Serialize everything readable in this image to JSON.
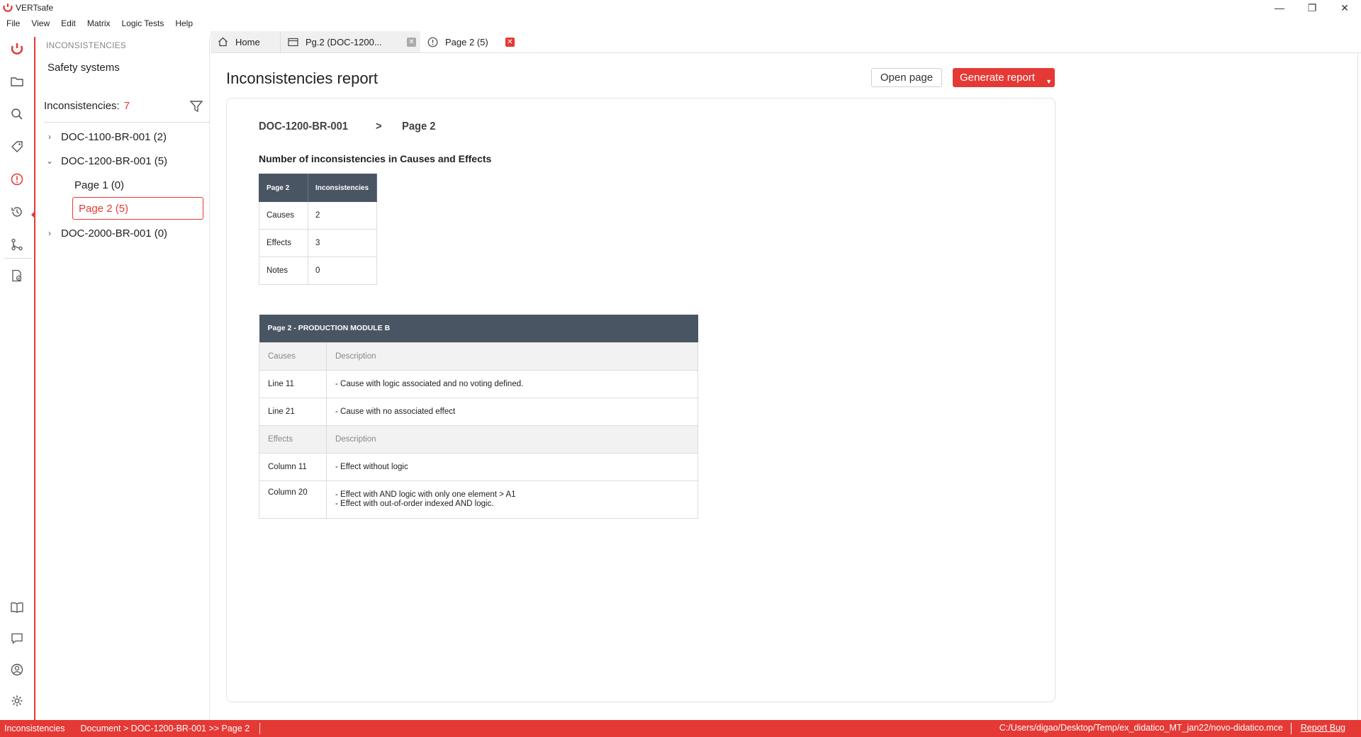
{
  "app": {
    "title": "VERTsafe"
  },
  "window": {
    "minimize": "—",
    "restore": "❐",
    "close": "✕"
  },
  "menu": [
    "File",
    "View",
    "Edit",
    "Matrix",
    "Logic Tests",
    "Help"
  ],
  "sidebar": {
    "section": "INCONSISTENCIES",
    "project": "Safety systems",
    "count_label": "Inconsistencies:",
    "count_value": "7",
    "tree": [
      {
        "label": "DOC-1100-BR-001 (2)",
        "expanded": false
      },
      {
        "label": "DOC-1200-BR-001 (5)",
        "expanded": true
      },
      {
        "label": "Page 1 (0)"
      },
      {
        "label": "Page 2 (5)",
        "selected": true
      },
      {
        "label": "DOC-2000-BR-001 (0)",
        "expanded": false
      }
    ]
  },
  "tabs": [
    {
      "label": "Home"
    },
    {
      "label": "Pg.2 (DOC-1200..."
    },
    {
      "label": "Page 2 (5)",
      "active": true
    }
  ],
  "main": {
    "title": "Inconsistencies report",
    "open_page": "Open page",
    "generate_report": "Generate report",
    "crumb_doc": "DOC-1200-BR-001",
    "crumb_sep": ">",
    "crumb_page": "Page 2",
    "summary_heading": "Number of inconsistencies in Causes and Effects",
    "summary_table": {
      "headers": [
        "Page 2",
        "Inconsistencies"
      ],
      "rows": [
        [
          "Causes",
          "2"
        ],
        [
          "Effects",
          "3"
        ],
        [
          "Notes",
          "0"
        ]
      ]
    },
    "detail_table": {
      "title": "Page 2 - PRODUCTION MODULE B",
      "causes_header": [
        "Causes",
        "Description"
      ],
      "causes": [
        [
          "Line 11",
          "- Cause with logic associated and no voting defined."
        ],
        [
          "Line 21",
          "- Cause with no associated effect"
        ]
      ],
      "effects_header": [
        "Effects",
        "Description"
      ],
      "effects": [
        [
          "Column 11",
          "- Effect without logic"
        ],
        [
          "Column 20",
          "- Effect with AND logic with only one element > A1",
          "- Effect with out-of-order indexed AND logic."
        ]
      ]
    }
  },
  "status": {
    "mode": "Inconsistencies",
    "doc": "Document > DOC-1200-BR-001 >> Page 2",
    "path": "C:/Users/digao/Desktop/Temp/ex_didatico_MT_jan22/novo-didatico.mce",
    "report_bug": "Report Bug"
  },
  "colors": {
    "accent": "#e53935",
    "table_header": "#4a5563"
  }
}
